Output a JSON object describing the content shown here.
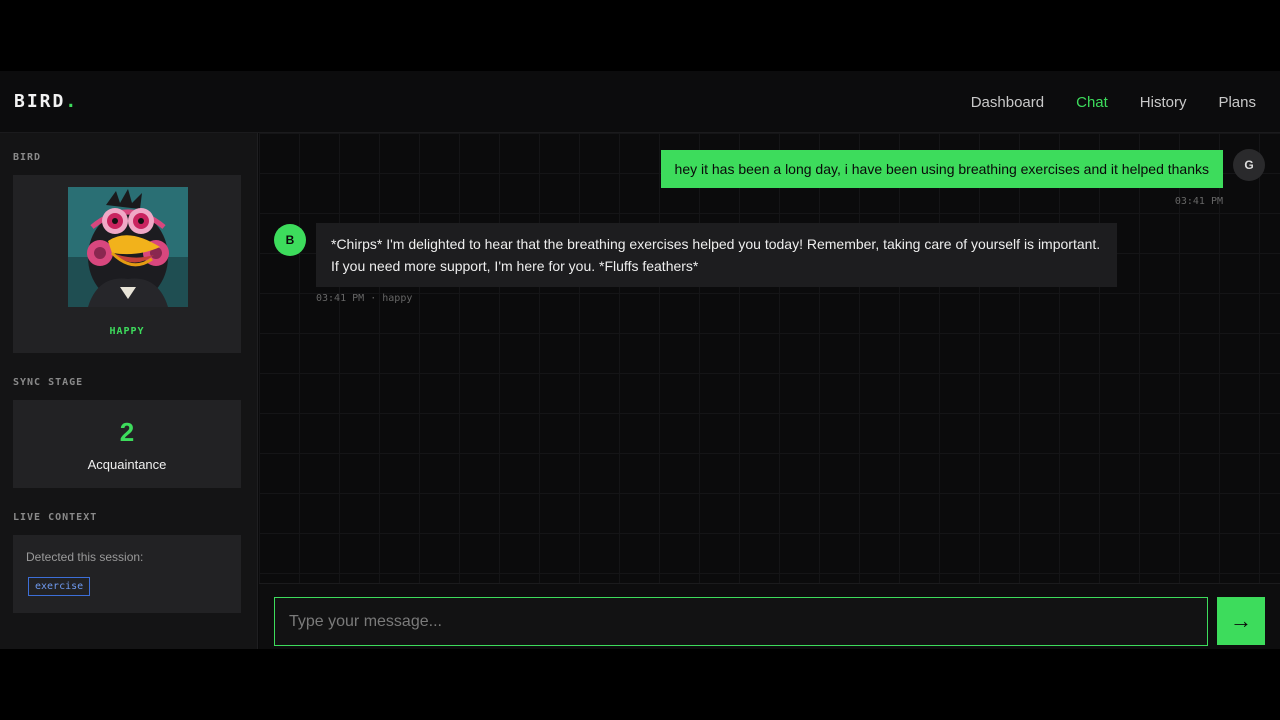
{
  "app": {
    "logo_text": "BIRD",
    "logo_dot": "."
  },
  "nav": {
    "items": [
      {
        "label": "Dashboard",
        "active": false
      },
      {
        "label": "Chat",
        "active": true
      },
      {
        "label": "History",
        "active": false
      },
      {
        "label": "Plans",
        "active": false
      }
    ]
  },
  "sidebar": {
    "bird_label": "BIRD",
    "mood": "HAPPY",
    "sync_label": "SYNC STAGE",
    "sync_stage": "2",
    "sync_stage_name": "Acquaintance",
    "context_label": "LIVE CONTEXT",
    "context_text": "Detected this session:",
    "context_tags": [
      "exercise"
    ]
  },
  "chat": {
    "messages": [
      {
        "sender": "user",
        "avatar": "G",
        "text": "hey it has been a long day, i have been using breathing exercises and it helped thanks",
        "time": "03:41 PM"
      },
      {
        "sender": "bot",
        "avatar": "B",
        "text": "*Chirps* I'm delighted to hear that the breathing exercises helped you today! Remember, taking care of yourself is important. If you need more support, I'm here for you. *Fluffs feathers*",
        "time": "03:41 PM",
        "mood": "happy",
        "meta_sep": "·"
      }
    ]
  },
  "composer": {
    "placeholder": "Type your message...",
    "value": "",
    "send_icon": "→"
  },
  "colors": {
    "accent": "#3ddc5c",
    "tag": "#6f9af0"
  }
}
